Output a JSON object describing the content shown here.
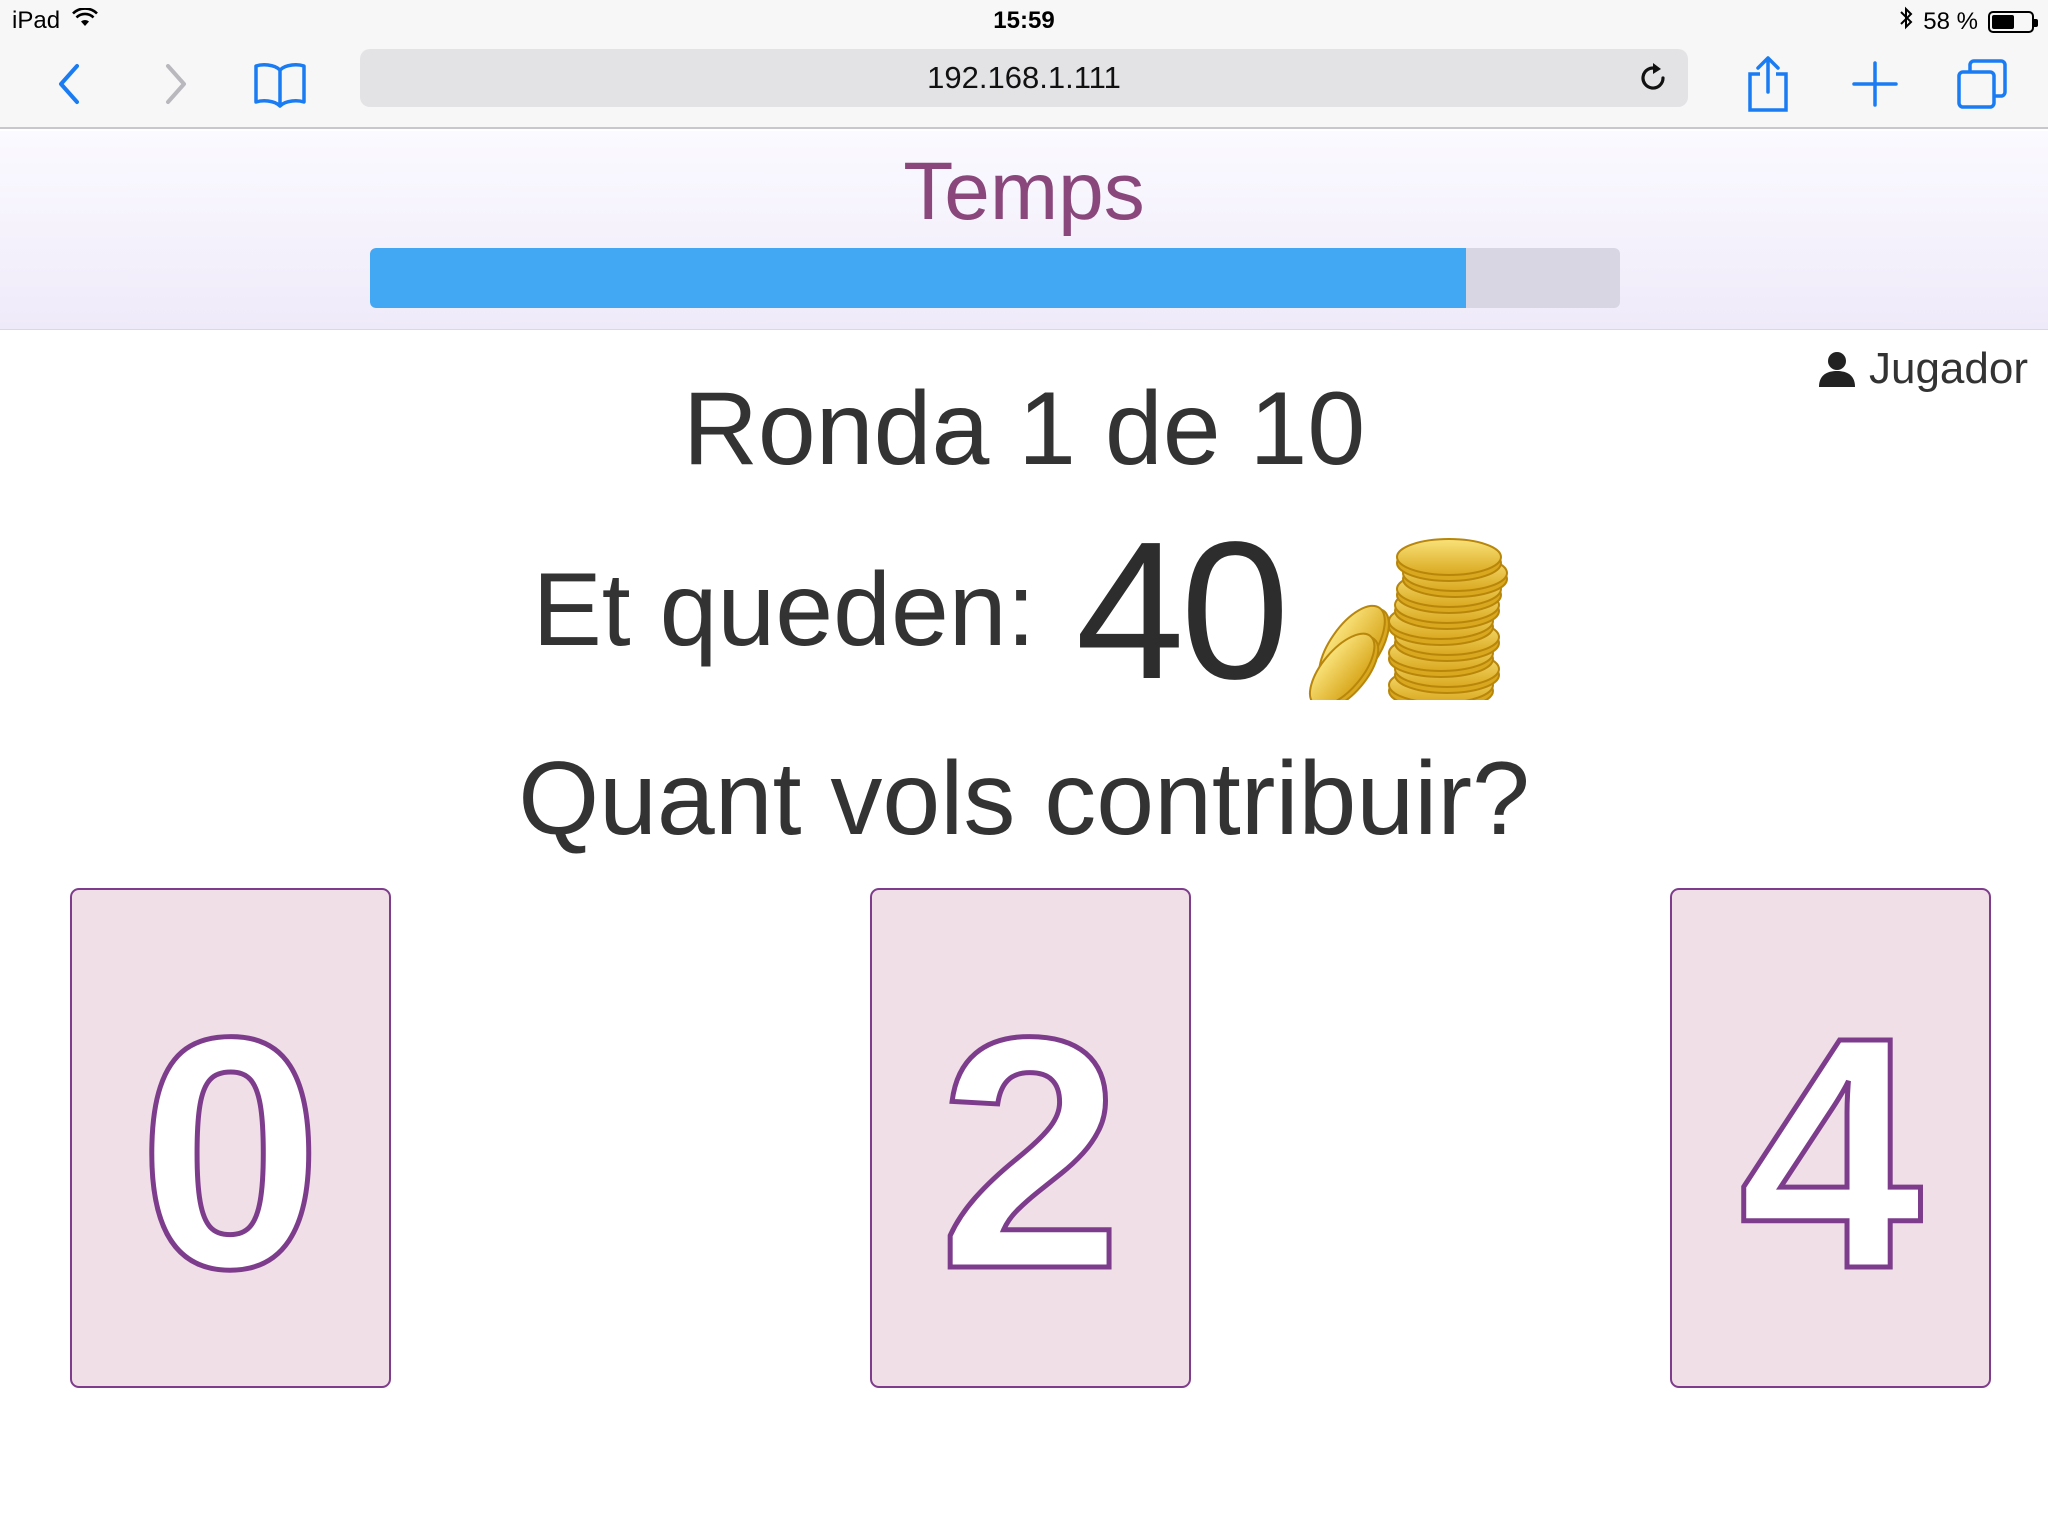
{
  "status_bar": {
    "device": "iPad",
    "time": "15:59",
    "battery_text": "58 %",
    "battery_level": 0.58
  },
  "browser": {
    "url": "192.168.1.111",
    "icons": [
      "back-icon",
      "forward-icon",
      "bookmarks-icon",
      "reload-icon",
      "share-icon",
      "new-tab-icon",
      "tabs-icon"
    ]
  },
  "timer": {
    "title": "Temps",
    "progress": 0.877,
    "fill_color": "#43a8f3"
  },
  "player": {
    "name": "Jugador"
  },
  "game": {
    "round_text": "Ronda 1 de 10",
    "remaining_label": "Et queden:",
    "remaining_value": "40",
    "question": "Quant vols contribuir?"
  },
  "options": [
    {
      "value": "0"
    },
    {
      "value": "2"
    },
    {
      "value": "4"
    }
  ],
  "colors": {
    "accent_purple": "#7d3d8c",
    "card_bg": "#f0dfe7",
    "title_purple": "#8a477c"
  }
}
